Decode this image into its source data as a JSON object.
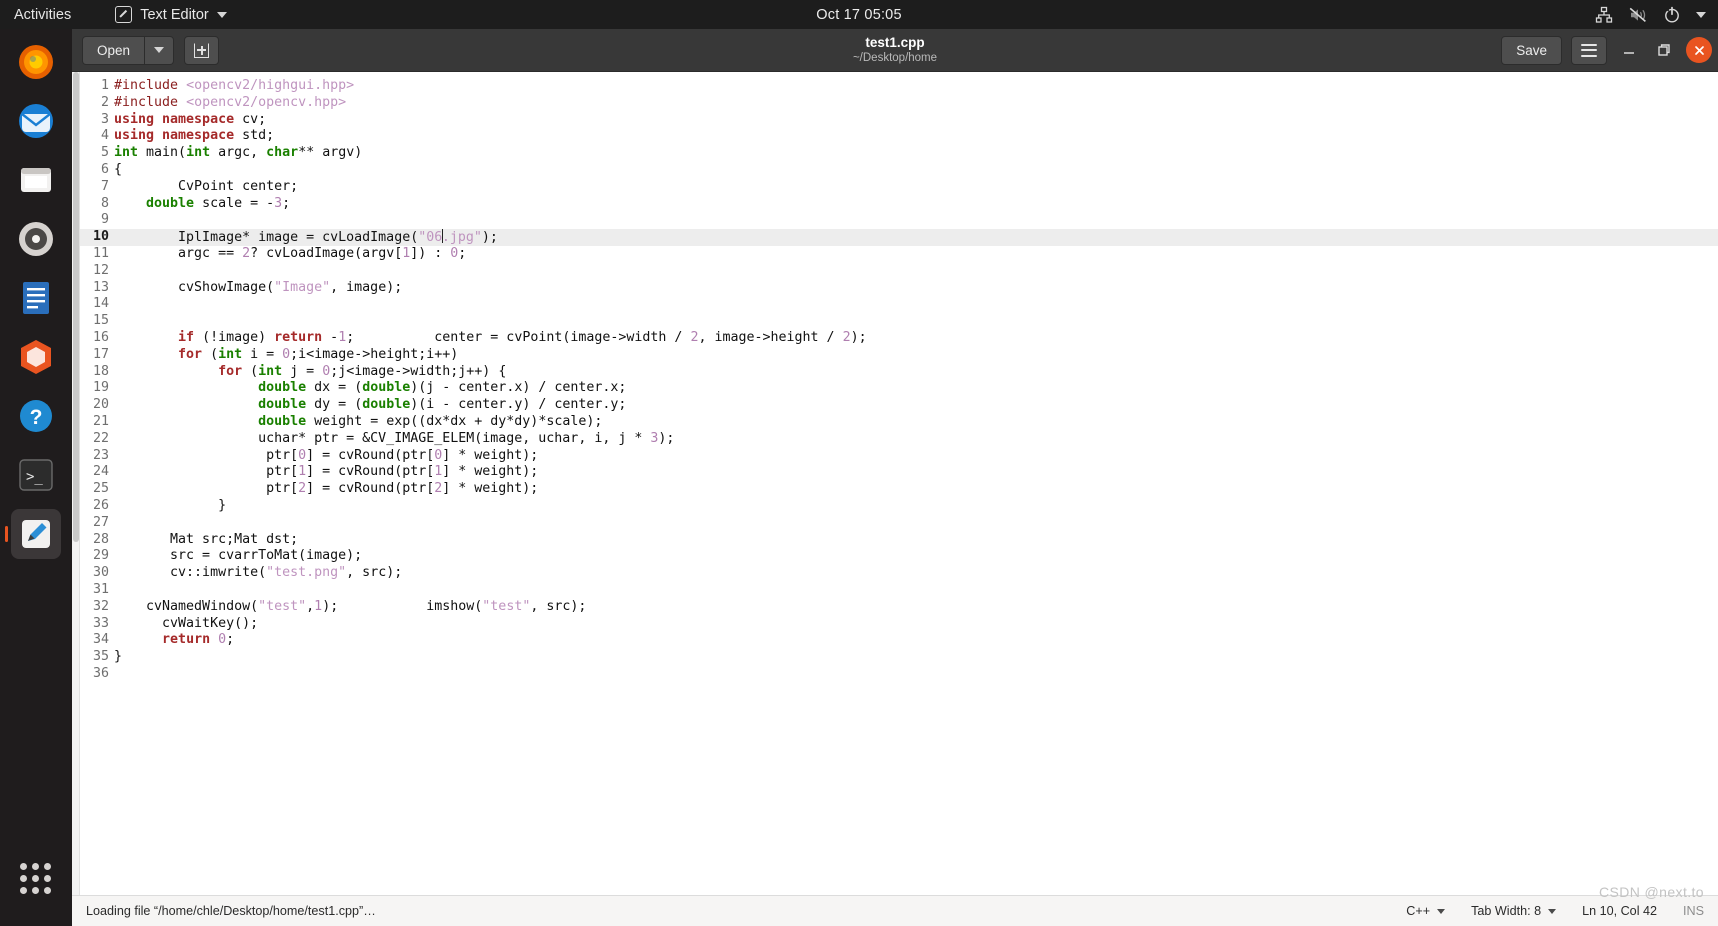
{
  "topbar": {
    "activities": "Activities",
    "app_name": "Text Editor",
    "clock": "Oct 17  05:05",
    "tray_icons": [
      "network-icon",
      "volume-muted-icon",
      "power-icon",
      "chevron-down-icon"
    ]
  },
  "dock": {
    "items": [
      {
        "name": "firefox",
        "label": "Firefox"
      },
      {
        "name": "thunderbird",
        "label": "Thunderbird"
      },
      {
        "name": "files",
        "label": "Files"
      },
      {
        "name": "rhythmbox",
        "label": "Rhythmbox"
      },
      {
        "name": "libreoffice-writer",
        "label": "LibreOffice Writer"
      },
      {
        "name": "ubuntu-software",
        "label": "Ubuntu Software"
      },
      {
        "name": "help",
        "label": "Help"
      },
      {
        "name": "terminal",
        "label": "Terminal"
      },
      {
        "name": "text-editor",
        "label": "Text Editor"
      }
    ],
    "show_apps": "Show Applications"
  },
  "headerbar": {
    "open_label": "Open",
    "open_menu_icon": "chevron-down-icon",
    "new_document_icon": "new-document-icon",
    "title": "test1.cpp",
    "subtitle": "~/Desktop/home",
    "save_label": "Save",
    "menu_icon": "hamburger-menu-icon",
    "minimize_icon": "minimize-icon",
    "maximize_icon": "maximize-icon",
    "close_icon": "close-icon"
  },
  "editor": {
    "current_line": 10,
    "total_lines": 36,
    "lines": [
      {
        "n": 1,
        "tokens": [
          {
            "c": "pp",
            "v": "#include"
          },
          {
            "c": "",
            "v": " "
          },
          {
            "c": "s",
            "v": "<opencv2/highgui.hpp>"
          }
        ]
      },
      {
        "n": 2,
        "tokens": [
          {
            "c": "pp",
            "v": "#include"
          },
          {
            "c": "",
            "v": " "
          },
          {
            "c": "s",
            "v": "<opencv2/opencv.hpp>"
          }
        ]
      },
      {
        "n": 3,
        "tokens": [
          {
            "c": "k",
            "v": "using namespace"
          },
          {
            "c": "",
            "v": " cv;"
          }
        ]
      },
      {
        "n": 4,
        "tokens": [
          {
            "c": "k",
            "v": "using namespace"
          },
          {
            "c": "",
            "v": " std;"
          }
        ]
      },
      {
        "n": 5,
        "tokens": [
          {
            "c": "t",
            "v": "int"
          },
          {
            "c": "",
            "v": " main("
          },
          {
            "c": "t",
            "v": "int"
          },
          {
            "c": "",
            "v": " argc, "
          },
          {
            "c": "t",
            "v": "char"
          },
          {
            "c": "",
            "v": "** argv)"
          }
        ]
      },
      {
        "n": 6,
        "tokens": [
          {
            "c": "",
            "v": "{"
          }
        ]
      },
      {
        "n": 7,
        "tokens": [
          {
            "c": "",
            "v": "        CvPoint center;"
          }
        ]
      },
      {
        "n": 8,
        "tokens": [
          {
            "c": "",
            "v": "    "
          },
          {
            "c": "t",
            "v": "double"
          },
          {
            "c": "",
            "v": " scale = -"
          },
          {
            "c": "n",
            "v": "3"
          },
          {
            "c": "",
            "v": ";"
          }
        ]
      },
      {
        "n": 9,
        "tokens": [
          {
            "c": "",
            "v": ""
          }
        ]
      },
      {
        "n": 10,
        "tokens": [
          {
            "c": "",
            "v": "        IplImage* image = cvLoadImage("
          },
          {
            "c": "s",
            "v": "\"06"
          },
          {
            "c": "caret",
            "v": ""
          },
          {
            "c": "s",
            "v": ".jpg\""
          },
          {
            "c": "",
            "v": ");"
          }
        ]
      },
      {
        "n": 11,
        "tokens": [
          {
            "c": "",
            "v": "        argc == "
          },
          {
            "c": "n",
            "v": "2"
          },
          {
            "c": "",
            "v": "? cvLoadImage(argv["
          },
          {
            "c": "n",
            "v": "1"
          },
          {
            "c": "",
            "v": "]) : "
          },
          {
            "c": "n",
            "v": "0"
          },
          {
            "c": "",
            "v": ";"
          }
        ]
      },
      {
        "n": 12,
        "tokens": [
          {
            "c": "",
            "v": ""
          }
        ]
      },
      {
        "n": 13,
        "tokens": [
          {
            "c": "",
            "v": "        cvShowImage("
          },
          {
            "c": "s",
            "v": "\"Image\""
          },
          {
            "c": "",
            "v": ", image);"
          }
        ]
      },
      {
        "n": 14,
        "tokens": [
          {
            "c": "",
            "v": ""
          }
        ]
      },
      {
        "n": 15,
        "tokens": [
          {
            "c": "",
            "v": ""
          }
        ]
      },
      {
        "n": 16,
        "tokens": [
          {
            "c": "",
            "v": "        "
          },
          {
            "c": "k",
            "v": "if"
          },
          {
            "c": "",
            "v": " (!image) "
          },
          {
            "c": "k",
            "v": "return"
          },
          {
            "c": "",
            "v": " -"
          },
          {
            "c": "n",
            "v": "1"
          },
          {
            "c": "",
            "v": ";          center = cvPoint(image->width / "
          },
          {
            "c": "n",
            "v": "2"
          },
          {
            "c": "",
            "v": ", image->height / "
          },
          {
            "c": "n",
            "v": "2"
          },
          {
            "c": "",
            "v": ");"
          }
        ]
      },
      {
        "n": 17,
        "tokens": [
          {
            "c": "",
            "v": "        "
          },
          {
            "c": "k",
            "v": "for"
          },
          {
            "c": "",
            "v": " ("
          },
          {
            "c": "t",
            "v": "int"
          },
          {
            "c": "",
            "v": " i = "
          },
          {
            "c": "n",
            "v": "0"
          },
          {
            "c": "",
            "v": ";i<image->height;i++)"
          }
        ]
      },
      {
        "n": 18,
        "tokens": [
          {
            "c": "",
            "v": "             "
          },
          {
            "c": "k",
            "v": "for"
          },
          {
            "c": "",
            "v": " ("
          },
          {
            "c": "t",
            "v": "int"
          },
          {
            "c": "",
            "v": " j = "
          },
          {
            "c": "n",
            "v": "0"
          },
          {
            "c": "",
            "v": ";j<image->width;j++) {"
          }
        ]
      },
      {
        "n": 19,
        "tokens": [
          {
            "c": "",
            "v": "                  "
          },
          {
            "c": "t",
            "v": "double"
          },
          {
            "c": "",
            "v": " dx = ("
          },
          {
            "c": "t",
            "v": "double"
          },
          {
            "c": "",
            "v": ")(j - center.x) / center.x;"
          }
        ]
      },
      {
        "n": 20,
        "tokens": [
          {
            "c": "",
            "v": "                  "
          },
          {
            "c": "t",
            "v": "double"
          },
          {
            "c": "",
            "v": " dy = ("
          },
          {
            "c": "t",
            "v": "double"
          },
          {
            "c": "",
            "v": ")(i - center.y) / center.y;"
          }
        ]
      },
      {
        "n": 21,
        "tokens": [
          {
            "c": "",
            "v": "                  "
          },
          {
            "c": "t",
            "v": "double"
          },
          {
            "c": "",
            "v": " weight = exp((dx*dx + dy*dy)*scale);"
          }
        ]
      },
      {
        "n": 22,
        "tokens": [
          {
            "c": "",
            "v": "                  uchar* ptr = &CV_IMAGE_ELEM(image, uchar, i, j * "
          },
          {
            "c": "n",
            "v": "3"
          },
          {
            "c": "",
            "v": ");"
          }
        ]
      },
      {
        "n": 23,
        "tokens": [
          {
            "c": "",
            "v": "                   ptr["
          },
          {
            "c": "n",
            "v": "0"
          },
          {
            "c": "",
            "v": "] = cvRound(ptr["
          },
          {
            "c": "n",
            "v": "0"
          },
          {
            "c": "",
            "v": "] * weight);"
          }
        ]
      },
      {
        "n": 24,
        "tokens": [
          {
            "c": "",
            "v": "                   ptr["
          },
          {
            "c": "n",
            "v": "1"
          },
          {
            "c": "",
            "v": "] = cvRound(ptr["
          },
          {
            "c": "n",
            "v": "1"
          },
          {
            "c": "",
            "v": "] * weight);"
          }
        ]
      },
      {
        "n": 25,
        "tokens": [
          {
            "c": "",
            "v": "                   ptr["
          },
          {
            "c": "n",
            "v": "2"
          },
          {
            "c": "",
            "v": "] = cvRound(ptr["
          },
          {
            "c": "n",
            "v": "2"
          },
          {
            "c": "",
            "v": "] * weight);"
          }
        ]
      },
      {
        "n": 26,
        "tokens": [
          {
            "c": "",
            "v": "             }"
          }
        ]
      },
      {
        "n": 27,
        "tokens": [
          {
            "c": "",
            "v": ""
          }
        ]
      },
      {
        "n": 28,
        "tokens": [
          {
            "c": "",
            "v": "       Mat src;Mat dst;"
          }
        ]
      },
      {
        "n": 29,
        "tokens": [
          {
            "c": "",
            "v": "       src = cvarrToMat(image);"
          }
        ]
      },
      {
        "n": 30,
        "tokens": [
          {
            "c": "",
            "v": "       cv::imwrite("
          },
          {
            "c": "s",
            "v": "\"test.png\""
          },
          {
            "c": "",
            "v": ", src);"
          }
        ]
      },
      {
        "n": 31,
        "tokens": [
          {
            "c": "",
            "v": ""
          }
        ]
      },
      {
        "n": 32,
        "tokens": [
          {
            "c": "",
            "v": "    cvNamedWindow("
          },
          {
            "c": "s",
            "v": "\"test\""
          },
          {
            "c": "",
            "v": ","
          },
          {
            "c": "n",
            "v": "1"
          },
          {
            "c": "",
            "v": ");           imshow("
          },
          {
            "c": "s",
            "v": "\"test\""
          },
          {
            "c": "",
            "v": ", src);"
          }
        ]
      },
      {
        "n": 33,
        "tokens": [
          {
            "c": "",
            "v": "      cvWaitKey();"
          }
        ]
      },
      {
        "n": 34,
        "tokens": [
          {
            "c": "",
            "v": "      "
          },
          {
            "c": "k",
            "v": "return"
          },
          {
            "c": "",
            "v": " "
          },
          {
            "c": "n",
            "v": "0"
          },
          {
            "c": "",
            "v": ";"
          }
        ]
      },
      {
        "n": 35,
        "tokens": [
          {
            "c": "",
            "v": "}"
          }
        ]
      },
      {
        "n": 36,
        "tokens": [
          {
            "c": "",
            "v": ""
          }
        ]
      }
    ]
  },
  "statusbar": {
    "message": "Loading file “/home/chle/Desktop/home/test1.cpp”…",
    "language": "C++",
    "tab_width": "Tab Width: 8",
    "position": "Ln 10, Col 42",
    "insert_mode": "INS"
  },
  "watermark": "CSDN @next.to",
  "colors": {
    "accent": "#e95420",
    "keyword": "#a52a2a",
    "type": "#1a8000",
    "string": "#bf94bf",
    "number": "#b07fb0",
    "headerbar": "#383838",
    "current_line": "#ededed"
  }
}
